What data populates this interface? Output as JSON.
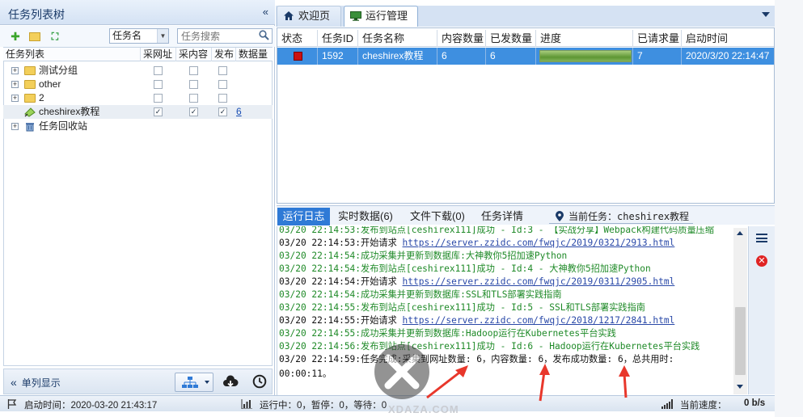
{
  "left_panel": {
    "title": "任务列表树",
    "collapse_label": "«",
    "field_select": "任务名",
    "search_placeholder": "任务搜索",
    "columns": [
      "任务列表",
      "采网址",
      "采内容",
      "发布",
      "数据量"
    ],
    "tree": [
      {
        "label": "测试分组",
        "type": "folder",
        "url": false,
        "content": false,
        "publish": false,
        "count": ""
      },
      {
        "label": "other",
        "type": "folder",
        "url": false,
        "content": false,
        "publish": false,
        "count": ""
      },
      {
        "label": "2",
        "type": "folder",
        "url": false,
        "content": false,
        "publish": false,
        "count": ""
      },
      {
        "label": "cheshirex教程",
        "type": "task",
        "url": true,
        "content": true,
        "publish": true,
        "count": "6"
      },
      {
        "label": "任务回收站",
        "type": "trash"
      }
    ],
    "bottom": {
      "single_column": "单列显示"
    }
  },
  "tabs": [
    {
      "label": "欢迎页",
      "icon": "home-icon"
    },
    {
      "label": "运行管理",
      "icon": "monitor-icon"
    }
  ],
  "grid": {
    "columns": [
      "状态",
      "任务ID",
      "任务名称",
      "内容数量",
      "已发数量",
      "进度",
      "已请求量",
      "启动时间"
    ],
    "row": {
      "status": "stopped",
      "id": "1592",
      "name": "cheshirex教程",
      "content_count": "6",
      "published": "6",
      "progress": 1.0,
      "requested": "7",
      "start_time": "2020/3/20 22:14:47"
    }
  },
  "log_tabs": {
    "log": "运行日志",
    "realtime": "实时数据(6)",
    "downloads": "文件下载(0)",
    "details": "任务详情",
    "current_task_label": "当前任务：",
    "current_task": "cheshirex教程"
  },
  "log_lines": [
    {
      "color": "g",
      "parts": [
        {
          "t": "03/20 22:14:53:发布到站点[ceshirex111]成功 - Id:3 - 【实战分享】Webpack构建代码质量压缩"
        }
      ]
    },
    {
      "color": "k",
      "parts": [
        {
          "t": "03/20 22:14:53:开始请求 "
        },
        {
          "t": "https://server.zzidc.com/fwqjc/2019/0321/2913.html",
          "u": true
        }
      ]
    },
    {
      "color": "g",
      "parts": [
        {
          "t": "03/20 22:14:54:成功采集并更新到数据库:大神教你5招加速Python"
        }
      ]
    },
    {
      "color": "g",
      "parts": [
        {
          "t": "03/20 22:14:54:发布到站点[ceshirex111]成功 - Id:4 - 大神教你5招加速Python"
        }
      ]
    },
    {
      "color": "k",
      "parts": [
        {
          "t": "03/20 22:14:54:开始请求 "
        },
        {
          "t": "https://server.zzidc.com/fwqjc/2019/0311/2905.html",
          "u": true
        }
      ]
    },
    {
      "color": "g",
      "parts": [
        {
          "t": "03/20 22:14:54:成功采集并更新到数据库:SSL和TLS部署实践指南"
        }
      ]
    },
    {
      "color": "g",
      "parts": [
        {
          "t": "03/20 22:14:55:发布到站点[ceshirex111]成功 - Id:5 - SSL和TLS部署实践指南"
        }
      ]
    },
    {
      "color": "k",
      "parts": [
        {
          "t": "03/20 22:14:55:开始请求 "
        },
        {
          "t": "https://server.zzidc.com/fwqjc/2018/1217/2841.html",
          "u": true
        }
      ]
    },
    {
      "color": "g",
      "parts": [
        {
          "t": "03/20 22:14:55:成功采集并更新到数据库:Hadoop运行在Kubernetes平台实践"
        }
      ]
    },
    {
      "color": "g",
      "parts": [
        {
          "t": "03/20 22:14:56:发布到站点[ceshirex111]成功 - Id:6 - Hadoop运行在Kubernetes平台实践"
        }
      ]
    },
    {
      "color": "k",
      "parts": [
        {
          "t": "03/20 22:14:59:任务完成:采集到网址数量: 6，内容数量: 6，发布成功数量: 6，总共用时:"
        }
      ]
    },
    {
      "color": "k",
      "parts": [
        {
          "t": "00:00:11。"
        }
      ]
    }
  ],
  "statusbar": {
    "start_time": "启动时间：2020-03-20 21:43:17",
    "running": "运行中：0，暂停：0，等待：0",
    "speed_label": "当前速度：",
    "speed": "0 b/s"
  },
  "watermark": "XDAZA.COM",
  "colors": {
    "accent": "#2f7ad6",
    "selected_row": "#3e8fe0",
    "log_green": "#1f8a28",
    "arrow": "#e8372b",
    "stop_red": "#cc1111"
  }
}
